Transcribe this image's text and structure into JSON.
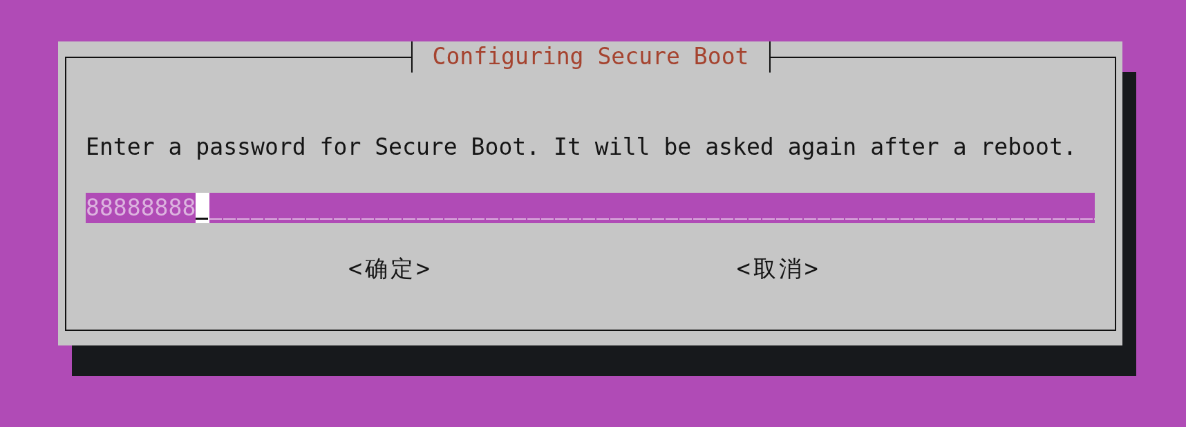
{
  "dialog": {
    "title": "Configuring Secure Boot",
    "message": "Enter a password for Secure Boot. It will be asked again after a reboot.",
    "password_field": {
      "value": "88888888",
      "focused": true
    },
    "buttons": [
      {
        "label": "<确定>"
      },
      {
        "label": "<取消>"
      }
    ]
  }
}
